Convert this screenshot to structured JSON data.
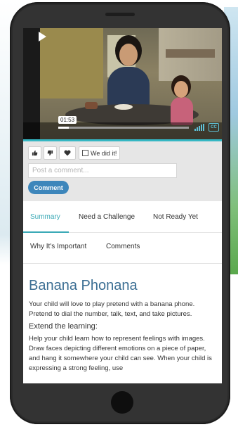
{
  "video": {
    "time": "01:53",
    "progress": 0.08
  },
  "reactions": {
    "did_it_label": "We did it!",
    "comment_placeholder": "Post a comment...",
    "comment_button": "Comment"
  },
  "tabs": [
    {
      "label": "Summary"
    },
    {
      "label": "Need a Challenge"
    },
    {
      "label": "Not Ready Yet"
    },
    {
      "label": "Why It's Important"
    },
    {
      "label": "Comments"
    }
  ],
  "content": {
    "title": "Banana Phonana",
    "intro": "Your child will love to play pretend with a banana phone. Pretend to dial the number, talk, text, and take pictures.",
    "subheading": "Extend the learning:",
    "body": "Help your child learn how to represent feelings with images. Draw faces depicting different emotions on a piece of paper, and hang it somewhere your child can see. When your child is expressing a strong feeling, use"
  },
  "colors": {
    "accent": "#3aa9b6",
    "title": "#3b6e93",
    "button": "#3d86bb"
  }
}
